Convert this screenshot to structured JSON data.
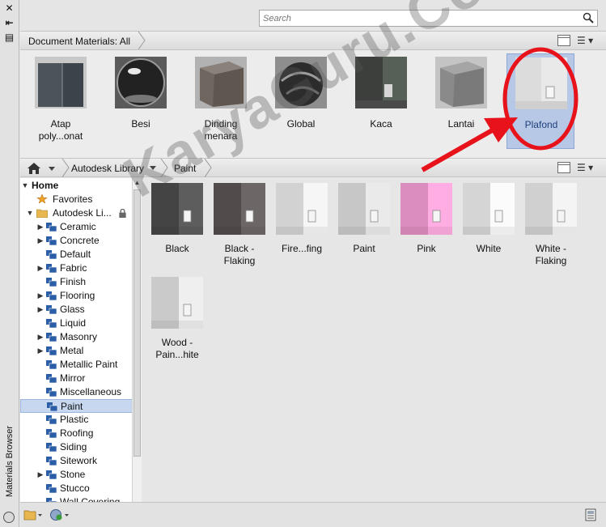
{
  "panel": {
    "vertical_title": "Materials Browser"
  },
  "strip": {
    "close": "✕",
    "autohide": "⇤",
    "menu": "▤"
  },
  "search": {
    "placeholder": "Search"
  },
  "document_materials": {
    "title": "Document Materials: All",
    "items": [
      {
        "label": "Atap\npoly...onat",
        "kind": "glass-box"
      },
      {
        "label": "Besi",
        "kind": "chrome-sphere"
      },
      {
        "label": "Dinding\nmenara",
        "kind": "granite-cube"
      },
      {
        "label": "Global",
        "kind": "dark-sphere"
      },
      {
        "label": "Kaca",
        "kind": "dark-room"
      },
      {
        "label": "Lantai",
        "kind": "grey-cube"
      },
      {
        "label": "Plafond",
        "kind": "white-room",
        "selected": true
      }
    ]
  },
  "breadcrumb": {
    "library": "Autodesk Library",
    "folder": "Paint"
  },
  "tree": {
    "home": "Home",
    "favorites": "Favorites",
    "library": "Autodesk Li...",
    "categories": [
      {
        "label": "Ceramic",
        "expandable": true
      },
      {
        "label": "Concrete",
        "expandable": true
      },
      {
        "label": "Default",
        "expandable": false
      },
      {
        "label": "Fabric",
        "expandable": true
      },
      {
        "label": "Finish",
        "expandable": false
      },
      {
        "label": "Flooring",
        "expandable": true
      },
      {
        "label": "Glass",
        "expandable": true
      },
      {
        "label": "Liquid",
        "expandable": false
      },
      {
        "label": "Masonry",
        "expandable": true
      },
      {
        "label": "Metal",
        "expandable": true
      },
      {
        "label": "Metallic Paint",
        "expandable": false
      },
      {
        "label": "Mirror",
        "expandable": false
      },
      {
        "label": "Miscellaneous",
        "expandable": false
      },
      {
        "label": "Paint",
        "expandable": false,
        "selected": true
      },
      {
        "label": "Plastic",
        "expandable": false
      },
      {
        "label": "Roofing",
        "expandable": false
      },
      {
        "label": "Siding",
        "expandable": false
      },
      {
        "label": "Sitework",
        "expandable": false
      },
      {
        "label": "Stone",
        "expandable": true
      },
      {
        "label": "Stucco",
        "expandable": false
      },
      {
        "label": "Wall Covering",
        "expandable": false
      }
    ]
  },
  "library_items": [
    {
      "label": "Black",
      "color": "#4a4a4a"
    },
    {
      "label": "Black -\nFlaking",
      "color": "#5a5252"
    },
    {
      "label": "Fire...fing",
      "color": "#e4e4e4"
    },
    {
      "label": "Paint",
      "color": "#d8d8d8"
    },
    {
      "label": "Pink",
      "color": "#ef9ad0"
    },
    {
      "label": "White",
      "color": "#e8e8e8"
    },
    {
      "label": "White -\nFlaking",
      "color": "#e2e2e2"
    },
    {
      "label": "Wood -\nPain...hite",
      "color": "#dcdcdc"
    }
  ],
  "watermark": "KaryaGuru.Com",
  "colors": {
    "selection": "#b6c8e6",
    "annotation": "#e8121b"
  }
}
